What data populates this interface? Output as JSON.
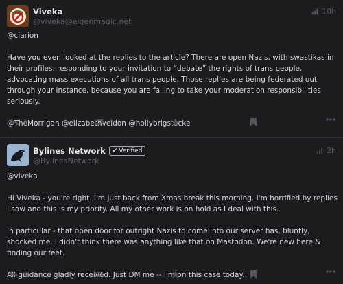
{
  "posts": [
    {
      "display_name": "Viveka",
      "handle": "@viveka@eigenmagic.net",
      "time": "10h",
      "mention": "@clarion",
      "paragraph1": "Have you even looked at the replies to the article? There are open Nazis, with swastikas in their profiles, responding to your invitation to “debate” the rights of trans people, advocating mass executions of all trans people. Those replies are being federated out through your instance, because you are failing to take your moderation responsibilities seriously.",
      "mentions_footer": "@TheMorrigan @elizabethveldon @hollybrigstocke",
      "reply_count": "1",
      "avatar_icon": "no-symbol-avatar-icon"
    },
    {
      "display_name": "Bylines Network",
      "verified_label": "Verified",
      "handle": "@BylinesNetwork",
      "time": "2h",
      "mention": "@viveka",
      "paragraph1": "Hi Viveka - you're right. I'm just back from Xmas break this morning. I'm horrified by replies I saw and this is my priority. All my other work is on hold as I deal with this.",
      "paragraph2": "In particular - that open door for outright Nazis to come into our server has, bluntly, shocked me. I didn't think there was anything like that on Mastodon. We're new here & finding our feet.",
      "paragraph3": "All guidance gladly received. Just DM me -- I'm on this case today.",
      "reply_count": "0",
      "avatar_icon": "raven-avatar-icon"
    }
  ],
  "icons": {
    "reply": "reply-icon",
    "boost": "boost-icon",
    "favourite": "star-icon",
    "bookmark": "bookmark-icon",
    "more": "more-icon",
    "visibility": "globe-icon"
  },
  "colors": {
    "background": "#1c1c1f",
    "muted": "#55555e",
    "text": "#d4d4da"
  }
}
